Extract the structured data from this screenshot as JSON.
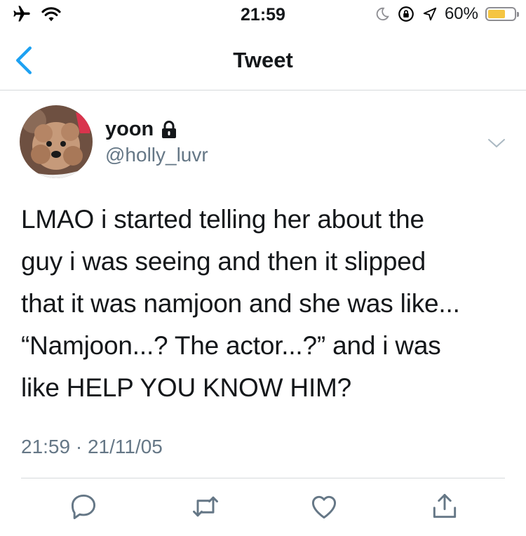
{
  "status_bar": {
    "time": "21:59",
    "battery_percent": "60%",
    "battery_level": 0.6
  },
  "nav": {
    "title": "Tweet"
  },
  "tweet": {
    "author_name": "yoon",
    "author_handle": "@holly_luvr",
    "lines": [
      "LMAO i started telling her about the",
      "guy i was seeing and then it slipped",
      "that it was namjoon and she was like...",
      "“Namjoon...? The actor...?” and i was",
      "like HELP YOU KNOW HIM?"
    ],
    "timestamp": "21:59 · 21/11/05"
  },
  "icons": [
    "airplane-icon",
    "wifi-icon",
    "moon-icon",
    "orientation-lock-icon",
    "location-icon",
    "battery-icon",
    "back-chevron-icon",
    "lock-icon",
    "chevron-down-icon",
    "reply-icon",
    "retweet-icon",
    "like-icon",
    "share-icon"
  ],
  "colors": {
    "accent": "#1da1f2",
    "text": "#14171a",
    "secondary": "#657786",
    "divider": "#d6d9db",
    "battery": "#f5c542"
  }
}
